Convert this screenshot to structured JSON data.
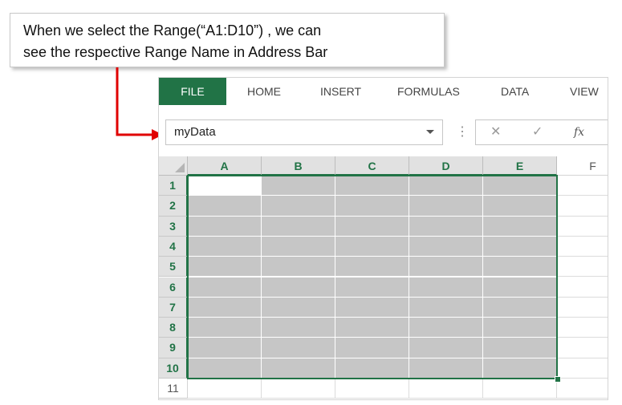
{
  "callout": {
    "line1": "When we select the Range(“A1:D10”) , we can",
    "line2": "see the respective Range Name in Address Bar"
  },
  "ribbon": {
    "tabs": [
      "FILE",
      "HOME",
      "INSERT",
      "FORMULAS",
      "DATA",
      "VIEW"
    ]
  },
  "formula_bar": {
    "name_box_value": "myData",
    "cancel_icon": "✕",
    "enter_icon": "✓",
    "fx_label": "fx"
  },
  "grid": {
    "columns": [
      "A",
      "B",
      "C",
      "D",
      "E",
      "F"
    ],
    "rows": [
      "1",
      "2",
      "3",
      "4",
      "5",
      "6",
      "7",
      "8",
      "9",
      "10",
      "11"
    ]
  },
  "colors": {
    "accent": "#217346",
    "selection_fill": "#c6c6c6",
    "arrow": "#e00000"
  }
}
